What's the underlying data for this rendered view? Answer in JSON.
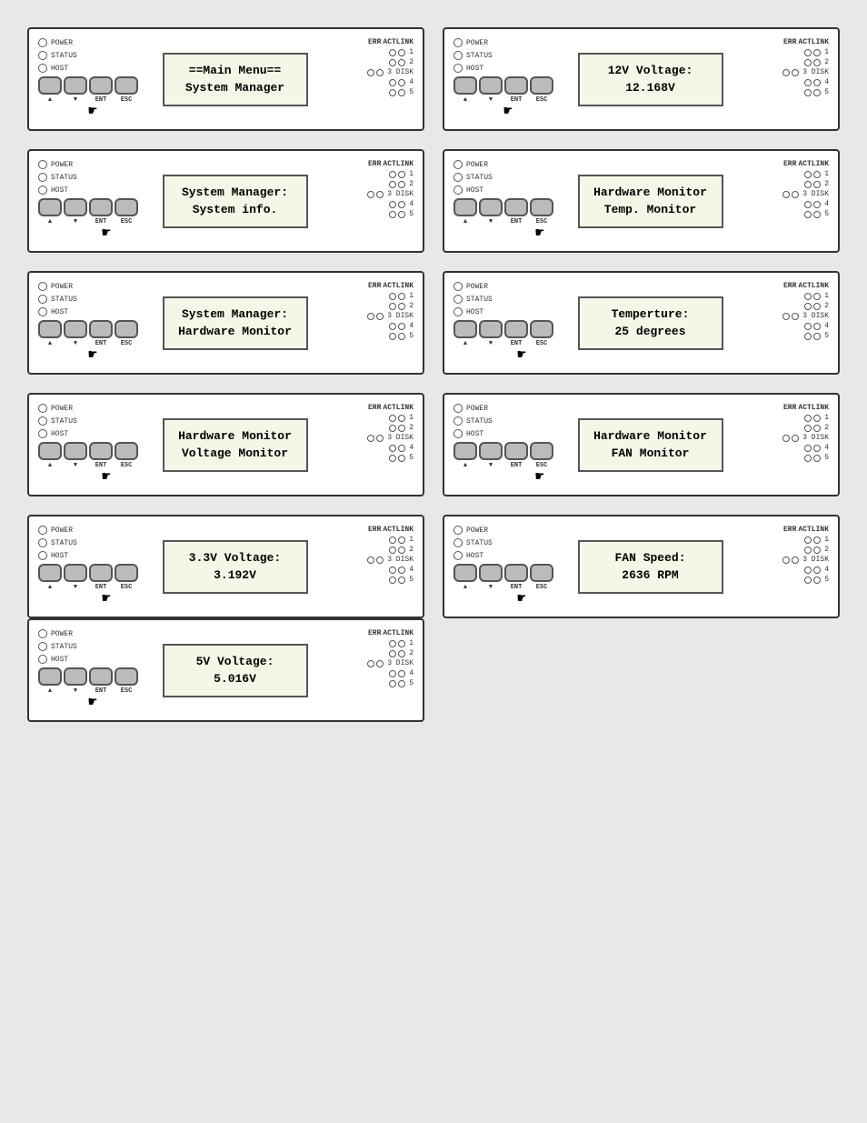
{
  "panels": [
    {
      "id": "main-menu",
      "display_line1": "==Main Menu==",
      "display_line2": "System Manager",
      "active_button": "down",
      "leds": [
        "POWER",
        "STATUS",
        "HOST"
      ],
      "buttons": [
        "▲",
        "▼",
        "ENT",
        "ESC"
      ]
    },
    {
      "id": "12v-voltage",
      "display_line1": "12V Voltage:",
      "display_line2": "12.168V",
      "active_button": "down",
      "leds": [
        "POWER",
        "STATUS",
        "HOST"
      ],
      "buttons": [
        "▲",
        "▼",
        "ENT",
        "ESC"
      ]
    },
    {
      "id": "system-manager-info",
      "display_line1": "System Manager:",
      "display_line2": "System info.",
      "active_button": "ent",
      "leds": [
        "POWER",
        "STATUS",
        "HOST"
      ],
      "buttons": [
        "▲",
        "▼",
        "ENT",
        "ESC"
      ]
    },
    {
      "id": "hardware-monitor-temp",
      "display_line1": "Hardware Monitor",
      "display_line2": "Temp. Monitor",
      "active_button": "esc",
      "leds": [
        "POWER",
        "STATUS",
        "HOST"
      ],
      "buttons": [
        "▲",
        "▼",
        "ENT",
        "ESC"
      ]
    },
    {
      "id": "system-manager-hardware",
      "display_line1": "System Manager:",
      "display_line2": "Hardware Monitor",
      "active_button": "down",
      "leds": [
        "POWER",
        "STATUS",
        "HOST"
      ],
      "buttons": [
        "▲",
        "▼",
        "ENT",
        "ESC"
      ]
    },
    {
      "id": "temperature",
      "display_line1": "Temperture:",
      "display_line2": "25 degrees",
      "active_button": "ent",
      "leds": [
        "POWER",
        "STATUS",
        "HOST"
      ],
      "buttons": [
        "▲",
        "▼",
        "ENT",
        "ESC"
      ]
    },
    {
      "id": "voltage-monitor",
      "display_line1": "Hardware Monitor",
      "display_line2": "Voltage Monitor",
      "active_button": "ent",
      "leds": [
        "POWER",
        "STATUS",
        "HOST"
      ],
      "buttons": [
        "▲",
        "▼",
        "ENT",
        "ESC"
      ]
    },
    {
      "id": "fan-monitor",
      "display_line1": "Hardware Monitor",
      "display_line2": "FAN Monitor",
      "active_button": "esc",
      "leds": [
        "POWER",
        "STATUS",
        "HOST"
      ],
      "buttons": [
        "▲",
        "▼",
        "ENT",
        "ESC"
      ]
    },
    {
      "id": "3v3-voltage",
      "display_line1": "3.3V Voltage:",
      "display_line2": "3.192V",
      "active_button": "ent",
      "leds": [
        "POWER",
        "STATUS",
        "HOST"
      ],
      "buttons": [
        "▲",
        "▼",
        "ENT",
        "ESC"
      ]
    },
    {
      "id": "fan-speed",
      "display_line1": "FAN Speed:",
      "display_line2": "2636 RPM",
      "active_button": "ent",
      "leds": [
        "POWER",
        "STATUS",
        "HOST"
      ],
      "buttons": [
        "▲",
        "▼",
        "ENT",
        "ESC"
      ]
    },
    {
      "id": "5v-voltage",
      "display_line1": "5V Voltage:",
      "display_line2": "5.016V",
      "active_button": "down",
      "leds": [
        "POWER",
        "STATUS",
        "HOST"
      ],
      "buttons": [
        "▲",
        "▼",
        "ENT",
        "ESC"
      ]
    }
  ],
  "disk_labels": [
    "1",
    "2",
    "3 DISK",
    "4",
    "5"
  ],
  "err_label": "ERR",
  "actlink_label": "ACTLINK"
}
